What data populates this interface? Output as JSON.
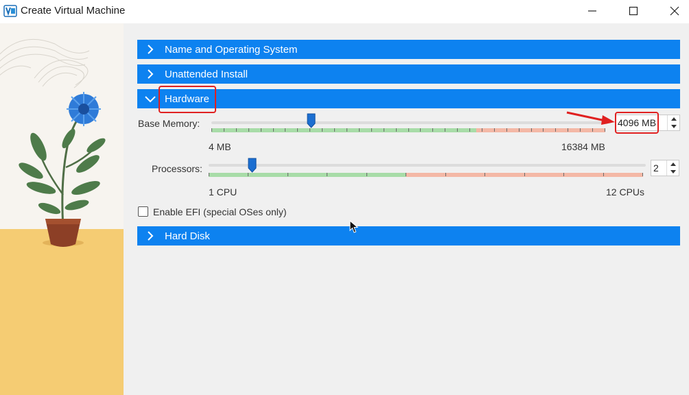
{
  "window": {
    "title": "Create Virtual Machine",
    "icons": {
      "app": "virtualbox-app-icon",
      "minimize": "minimize-icon",
      "maximize": "maximize-icon",
      "close": "close-icon"
    }
  },
  "sections": {
    "name_os": {
      "label": "Name and Operating System",
      "expanded": false
    },
    "unattended": {
      "label": "Unattended Install",
      "expanded": false
    },
    "hardware": {
      "label": "Hardware",
      "expanded": true
    },
    "hard_disk": {
      "label": "Hard Disk",
      "expanded": false
    }
  },
  "hardware": {
    "base_memory": {
      "label": "Base Memory:",
      "value": "4096 MB",
      "min_label": "4 MB",
      "max_label": "16384 MB",
      "min": 4,
      "max": 16384,
      "current": 4096
    },
    "processors": {
      "label": "Processors:",
      "value": "2",
      "min_label": "1 CPU",
      "max_label": "12 CPUs",
      "min": 1,
      "max": 12,
      "current": 2
    },
    "efi": {
      "label": "Enable EFI (special OSes only)",
      "checked": false
    }
  },
  "colors": {
    "section_bar": "#0d82f0",
    "highlight": "#e02020",
    "scale_safe": "#a8dca8",
    "scale_warn": "#f4b8a6",
    "background": "#f0f0f0"
  }
}
